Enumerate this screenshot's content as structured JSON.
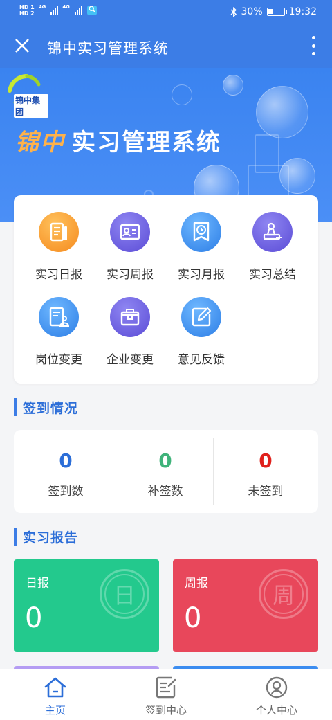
{
  "status_bar": {
    "sim1": "HD 1",
    "sim2": "HD 2",
    "net1": "4G",
    "net2": "4G",
    "bluetooth": "bluetooth-icon",
    "battery_percent": "30%",
    "battery_level": 0.3,
    "time": "19:32"
  },
  "app_bar": {
    "title": "锦中实习管理系统",
    "close_icon": "close-icon",
    "more_icon": "more-vertical-icon"
  },
  "banner": {
    "logo_text": "锦中集团",
    "hero_accent": "锦中",
    "hero_title": "实习管理系统"
  },
  "menu": {
    "items": [
      {
        "label": "实习日报",
        "icon": "daily-report-icon",
        "color": "#f58a1e"
      },
      {
        "label": "实习周报",
        "icon": "weekly-report-icon",
        "color": "#5b4cd6"
      },
      {
        "label": "实习月报",
        "icon": "monthly-report-icon",
        "color": "#2d7ee6"
      },
      {
        "label": "实习总结",
        "icon": "summary-icon",
        "color": "#5b4cd6"
      },
      {
        "label": "岗位变更",
        "icon": "position-change-icon",
        "color": "#2d7ee6"
      },
      {
        "label": "企业变更",
        "icon": "company-change-icon",
        "color": "#5b4cd6"
      },
      {
        "label": "意见反馈",
        "icon": "feedback-icon",
        "color": "#2d7ee6"
      }
    ]
  },
  "signin": {
    "section_title": "签到情况",
    "stats": [
      {
        "label": "签到数",
        "value": "0",
        "color": "#2c6ed8"
      },
      {
        "label": "补签数",
        "value": "0",
        "color": "#3fb37a"
      },
      {
        "label": "未签到",
        "value": "0",
        "color": "#e0211c"
      }
    ]
  },
  "reports": {
    "section_title": "实习报告",
    "cards": [
      {
        "title": "日报",
        "value": "0",
        "stamp": "日",
        "color": "#23c98d"
      },
      {
        "title": "周报",
        "value": "0",
        "stamp": "周",
        "color": "#e8475b"
      }
    ],
    "next_row_colors": [
      "#b49cf3",
      "#3c8df0"
    ]
  },
  "bottom_nav": {
    "items": [
      {
        "label": "主页",
        "icon": "home-icon",
        "active": true
      },
      {
        "label": "签到中心",
        "icon": "checkin-icon",
        "active": false
      },
      {
        "label": "个人中心",
        "icon": "profile-icon",
        "active": false
      }
    ]
  },
  "colors": {
    "primary": "#3c7de6",
    "accent": "#ffb24a"
  }
}
